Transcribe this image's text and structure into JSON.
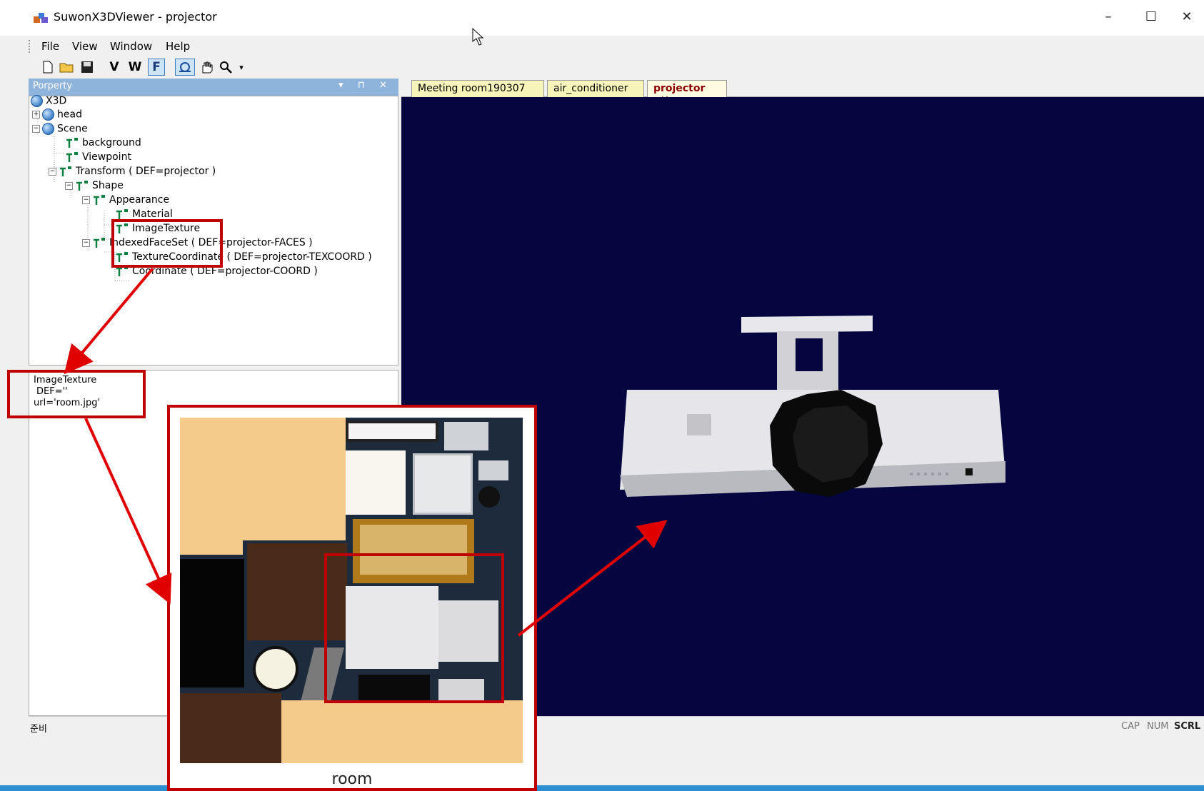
{
  "window": {
    "title": "SuwonX3DViewer - projector",
    "controls": {
      "minimize": "–",
      "maximize": "☐",
      "close": "✕"
    }
  },
  "menu": [
    {
      "label": "File"
    },
    {
      "label": "View"
    },
    {
      "label": "Window"
    },
    {
      "label": "Help"
    }
  ],
  "toolbar": {
    "v_label": "V",
    "w_label": "W",
    "f_label": "F",
    "icons": [
      "new-file-icon",
      "open-folder-icon",
      "save-icon",
      "rotate-icon",
      "pan-hand-icon",
      "zoom-icon"
    ]
  },
  "panel": {
    "title": "Porperty",
    "controls": "▾ ⊓ ✕"
  },
  "tree": [
    {
      "label": "X3D"
    },
    {
      "label": "head",
      "toggle": "+"
    },
    {
      "label": "Scene",
      "toggle": "−"
    },
    {
      "label": "background"
    },
    {
      "label": "Viewpoint"
    },
    {
      "label": "Transform ( DEF=projector )",
      "toggle": "−"
    },
    {
      "label": "Shape",
      "toggle": "−"
    },
    {
      "label": "Appearance",
      "toggle": "−"
    },
    {
      "label": "Material"
    },
    {
      "label": "ImageTexture"
    },
    {
      "label": "IndexedFaceSet ( DEF=projector-FACES )",
      "toggle": "−"
    },
    {
      "label": "TextureCoordinate ( DEF=projector-TEXCOORD )"
    },
    {
      "label": "Coordinate ( DEF=projector-COORD )"
    }
  ],
  "properties": {
    "line1": "ImageTexture",
    "line2": "DEF=''",
    "line3": "url='room.jpg'"
  },
  "tabs": [
    {
      "label": "Meeting room190307"
    },
    {
      "label": "air_conditioner"
    },
    {
      "label": "projector",
      "close": "✕"
    }
  ],
  "status": {
    "ready": "준비",
    "cap": "CAP",
    "num": "NUM",
    "scrl": "SCRL"
  },
  "callout": {
    "caption": "room"
  },
  "colors": {
    "viewport_bg": "#05063f",
    "annotation_red": "#c00000",
    "panel_header": "#8fb4dc"
  }
}
